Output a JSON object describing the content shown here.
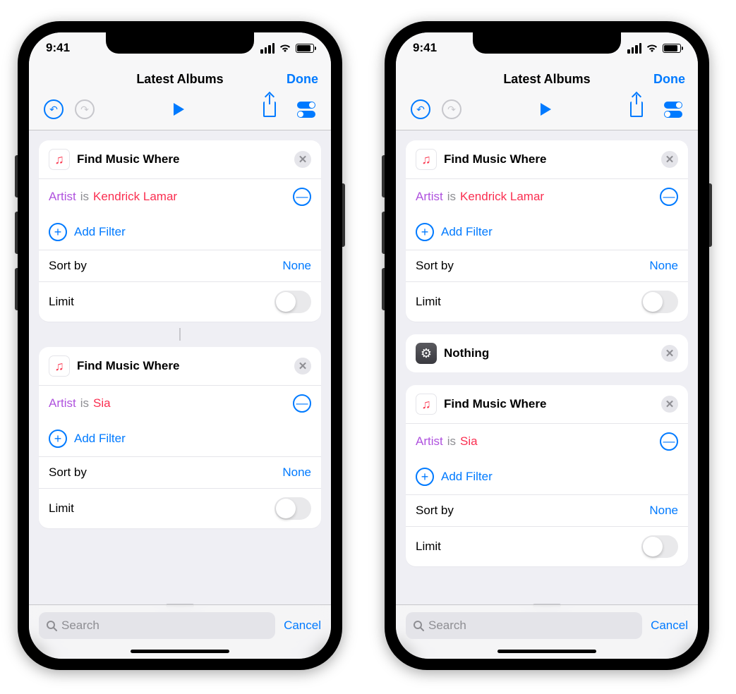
{
  "status": {
    "time": "9:41"
  },
  "nav": {
    "title": "Latest Albums",
    "done": "Done"
  },
  "search": {
    "placeholder": "Search",
    "cancel": "Cancel"
  },
  "labels": {
    "add_filter": "Add Filter",
    "sort_by": "Sort by",
    "limit": "Limit",
    "none": "None"
  },
  "phones": [
    {
      "cards": [
        {
          "type": "find",
          "title": "Find Music Where",
          "field": "Artist",
          "op": "is",
          "value": "Kendrick Lamar",
          "sort": "None",
          "limit": false
        },
        {
          "type": "find",
          "title": "Find Music Where",
          "field": "Artist",
          "op": "is",
          "value": "Sia",
          "sort": "None",
          "limit": false
        }
      ],
      "show_connector": true
    },
    {
      "cards": [
        {
          "type": "find",
          "title": "Find Music Where",
          "field": "Artist",
          "op": "is",
          "value": "Kendrick Lamar",
          "sort": "None",
          "limit": false
        },
        {
          "type": "nothing",
          "title": "Nothing"
        },
        {
          "type": "find",
          "title": "Find Music Where",
          "field": "Artist",
          "op": "is",
          "value": "Sia",
          "sort": "None",
          "limit": false
        }
      ],
      "show_connector": false
    }
  ]
}
